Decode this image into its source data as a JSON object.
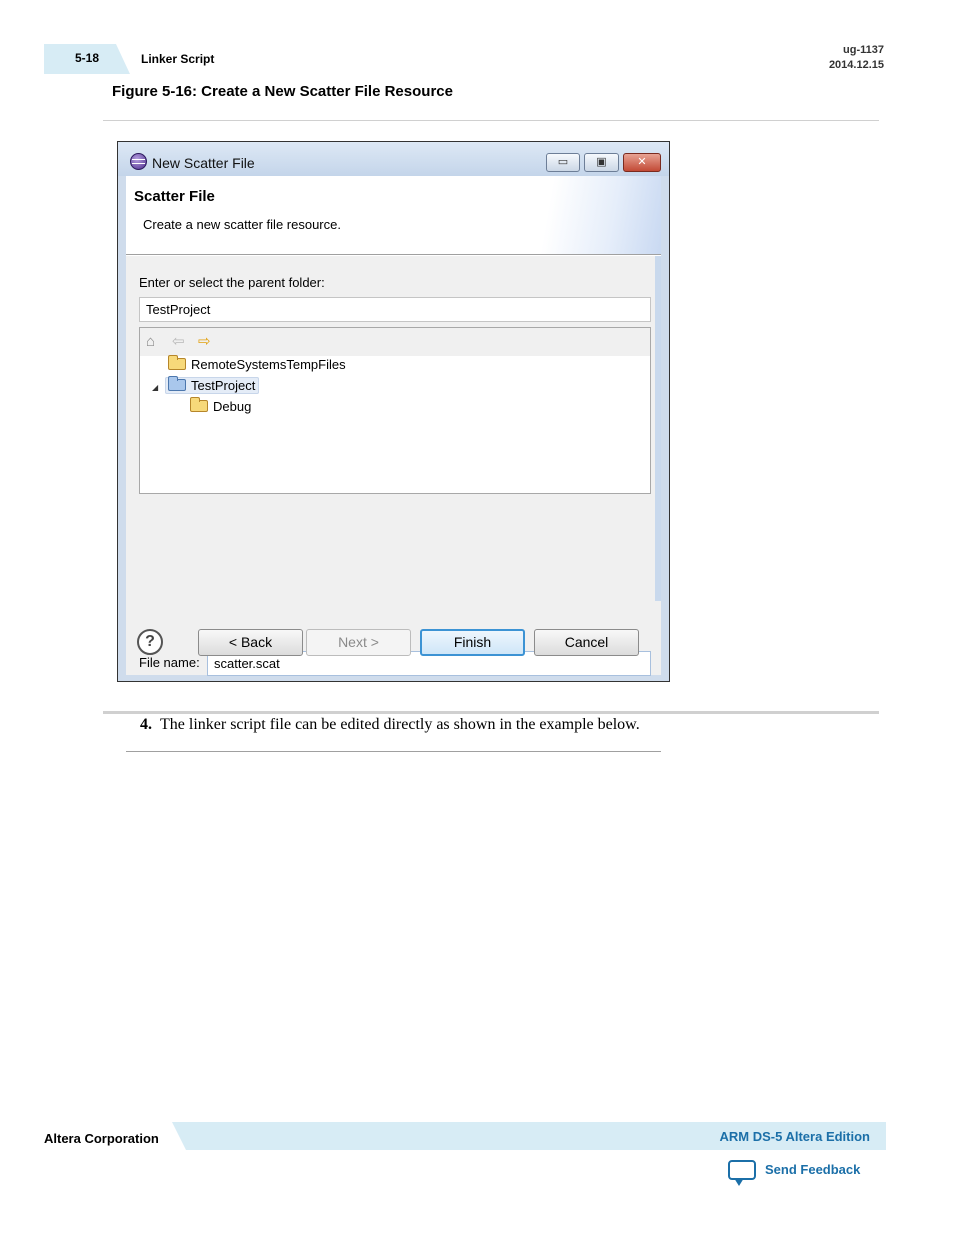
{
  "header": {
    "section_number": "5-18",
    "section_title": "Linker Script",
    "doc_id": "ug-1137",
    "doc_date": "2014.12.15"
  },
  "figure": {
    "caption": "Figure 5-16: Create a New Scatter File Resource"
  },
  "dialog": {
    "window_title": "New Scatter File",
    "minimize_glyph": "▭",
    "maximize_glyph": "▣",
    "close_glyph": "✕",
    "banner_title": "Scatter File",
    "banner_subtitle": "Create a new scatter file resource.",
    "parent_folder_label": "Enter or select the parent folder:",
    "parent_folder_value": "TestProject",
    "toolbar_icons": [
      "home-icon",
      "back-arrow-icon",
      "forward-arrow-icon"
    ],
    "tree": [
      {
        "label": "RemoteSystemsTempFiles",
        "icon": "folder-icon",
        "level": 1,
        "expanded": false
      },
      {
        "label": "TestProject",
        "icon": "project-folder-icon",
        "level": 1,
        "expanded": true,
        "selected": true
      },
      {
        "label": "Debug",
        "icon": "folder-icon",
        "level": 2,
        "expanded": false
      }
    ],
    "file_name_label": "File name:",
    "file_name_value": "scatter.scat",
    "buttons": {
      "back": "< Back",
      "next": "Next >",
      "finish": "Finish",
      "cancel": "Cancel"
    },
    "help_glyph": "?"
  },
  "body": {
    "step_number": "4.",
    "step_text": "The linker script file can be edited directly as shown in the example below."
  },
  "footer": {
    "company": "Altera Corporation",
    "product": "ARM DS-5 Altera Edition",
    "feedback": "Send Feedback"
  },
  "colors": {
    "accent": "#1b6fa8",
    "band": "#d7ecf5"
  }
}
